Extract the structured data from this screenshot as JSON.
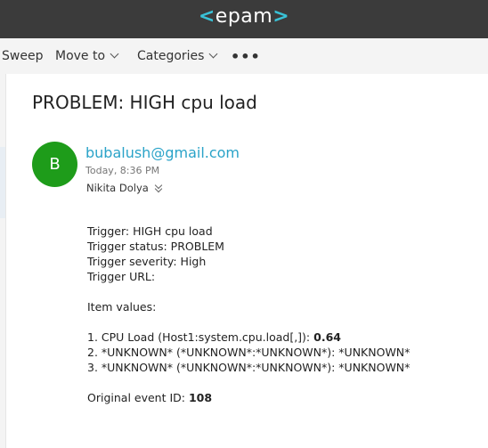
{
  "brand": {
    "prefix": "<",
    "name": "epam",
    "suffix": ">"
  },
  "toolbar": {
    "sweep_label": "Sweep",
    "move_label": "Move to",
    "categories_label": "Categories",
    "more_label": "•••"
  },
  "email": {
    "subject": "PROBLEM: HIGH cpu load",
    "avatar_initial": "B",
    "sender": "bubalush@gmail.com",
    "time": "Today, 8:36 PM",
    "recipient": "Nikita Dolya",
    "lines": {
      "trigger": "Trigger: HIGH cpu load",
      "status": "Trigger status: PROBLEM",
      "severity": "Trigger severity: High",
      "url": "Trigger URL:",
      "item_values": "Item values:",
      "item1_prefix": "1. CPU Load (Host1:system.cpu.load[,]):",
      "item1_value": "0.64",
      "item2": "2. *UNKNOWN* (*UNKNOWN*:*UNKNOWN*): *UNKNOWN*",
      "item3": "3. *UNKNOWN* (*UNKNOWN*:*UNKNOWN*): *UNKNOWN*",
      "event_prefix": "Original event ID:",
      "event_id": "108"
    }
  }
}
